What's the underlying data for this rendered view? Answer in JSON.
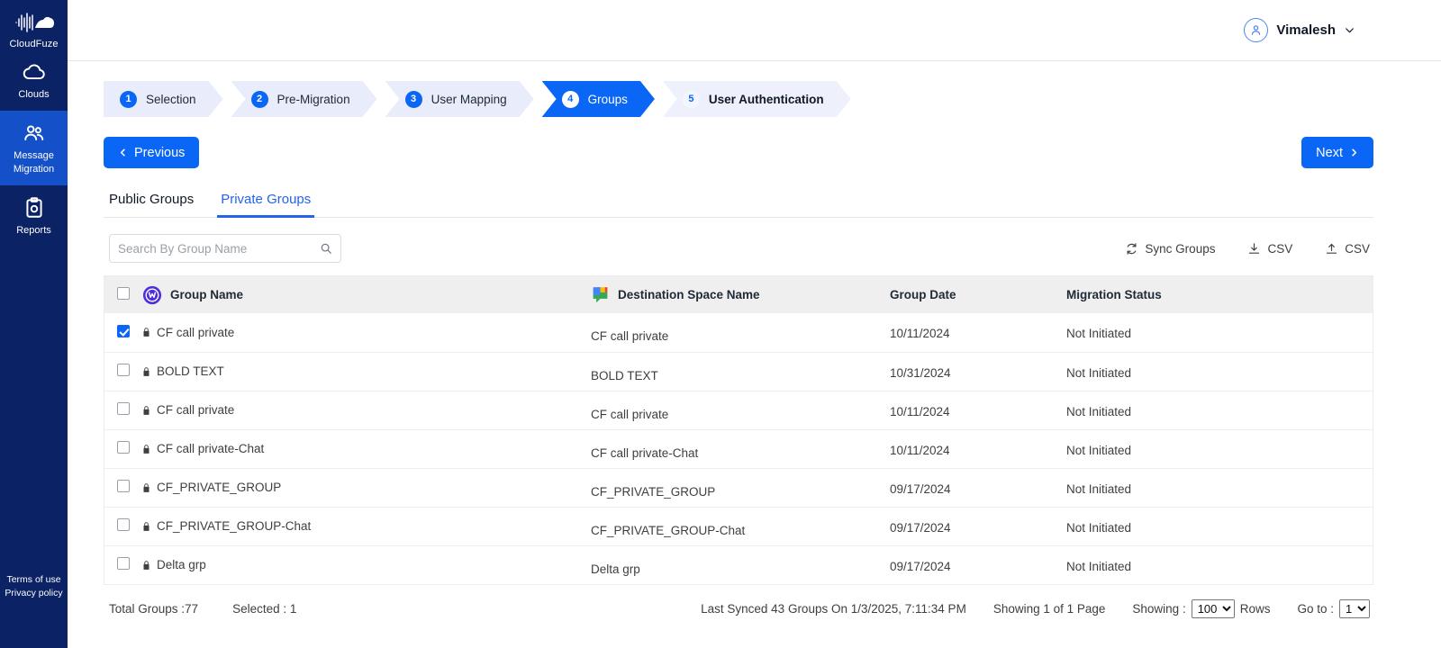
{
  "sidebar": {
    "brand": {
      "name": "CloudFuze",
      "logo_icon": "cloudfuze-logo-icon"
    },
    "items": [
      {
        "label": "Clouds",
        "icon": "cloud-icon",
        "active": false
      },
      {
        "label": "Message\nMigration",
        "label_line1": "Message",
        "label_line2": "Migration",
        "icon": "users-icon",
        "active": true
      },
      {
        "label": "Reports",
        "icon": "clipboard-icon",
        "active": false
      }
    ],
    "footer_links": [
      {
        "label": "Terms of use"
      },
      {
        "label": "Privacy policy"
      }
    ]
  },
  "topbar": {
    "user_name": "Vimalesh",
    "avatar_icon": "user-avatar-icon",
    "chevron_icon": "chevron-down-icon"
  },
  "stepper": {
    "steps": [
      {
        "num": "1",
        "label": "Selection",
        "state": "done"
      },
      {
        "num": "2",
        "label": "Pre-Migration",
        "state": "done"
      },
      {
        "num": "3",
        "label": "User Mapping",
        "state": "done"
      },
      {
        "num": "4",
        "label": "Groups",
        "state": "active"
      },
      {
        "num": "5",
        "label": "User Authentication",
        "state": "upcoming"
      }
    ]
  },
  "nav": {
    "previous_label": "Previous",
    "next_label": "Next",
    "prev_icon": "chevron-left-icon",
    "next_icon": "chevron-right-icon"
  },
  "tabs": [
    {
      "label": "Public Groups",
      "active": false
    },
    {
      "label": "Private Groups",
      "active": true
    }
  ],
  "search": {
    "placeholder": "Search By Group Name",
    "value": "",
    "icon": "search-icon"
  },
  "toolbar": {
    "sync_label": "Sync Groups",
    "sync_icon": "refresh-icon",
    "download_csv_label": "CSV",
    "download_icon": "download-icon",
    "upload_csv_label": "CSV",
    "upload_icon": "upload-icon"
  },
  "table": {
    "source_icon": "webex-icon",
    "destination_icon": "google-chat-icon",
    "headers": {
      "group_name": "Group Name",
      "destination_space_name": "Destination Space Name",
      "group_date": "Group Date",
      "migration_status": "Migration Status"
    },
    "rows": [
      {
        "checked": true,
        "lock_icon": "lock-icon",
        "group_name": "CF call private",
        "destination": "CF call private",
        "date": "10/11/2024",
        "status": "Not Initiated"
      },
      {
        "checked": false,
        "lock_icon": "lock-icon",
        "group_name": "BOLD TEXT",
        "destination": "BOLD TEXT",
        "date": "10/31/2024",
        "status": "Not Initiated"
      },
      {
        "checked": false,
        "lock_icon": "lock-icon",
        "group_name": "CF call private",
        "destination": "CF call private",
        "date": "10/11/2024",
        "status": "Not Initiated"
      },
      {
        "checked": false,
        "lock_icon": "lock-icon",
        "group_name": "CF call private-Chat",
        "destination": "CF call private-Chat",
        "date": "10/11/2024",
        "status": "Not Initiated"
      },
      {
        "checked": false,
        "lock_icon": "lock-icon",
        "group_name": "CF_PRIVATE_GROUP",
        "destination": "CF_PRIVATE_GROUP",
        "date": "09/17/2024",
        "status": "Not Initiated"
      },
      {
        "checked": false,
        "lock_icon": "lock-icon",
        "group_name": "CF_PRIVATE_GROUP-Chat",
        "destination": "CF_PRIVATE_GROUP-Chat",
        "date": "09/17/2024",
        "status": "Not Initiated"
      },
      {
        "checked": false,
        "lock_icon": "lock-icon",
        "group_name": "Delta grp",
        "destination": "Delta grp",
        "date": "09/17/2024",
        "status": "Not Initiated"
      }
    ]
  },
  "footer": {
    "total_groups": "Total Groups :77",
    "selected": "Selected : 1",
    "last_synced": "Last Synced 43 Groups On 1/3/2025, 7:11:34 PM",
    "showing_pages": "Showing 1 of 1 Page",
    "showing_label": "Showing :",
    "rows_label": "Rows",
    "rows_value": "100",
    "rows_options": [
      "100"
    ],
    "goto_label": "Go to :",
    "goto_value": "1",
    "goto_options": [
      "1"
    ]
  },
  "colors": {
    "sidebar_bg": "#0b2265",
    "sidebar_active": "#1450c8",
    "accent": "#0a66f5",
    "tab_active": "#2563eb",
    "step_done_bg": "#e8ecfb",
    "header_row_bg": "#efefef",
    "webex_purple": "#4f2fd9"
  }
}
